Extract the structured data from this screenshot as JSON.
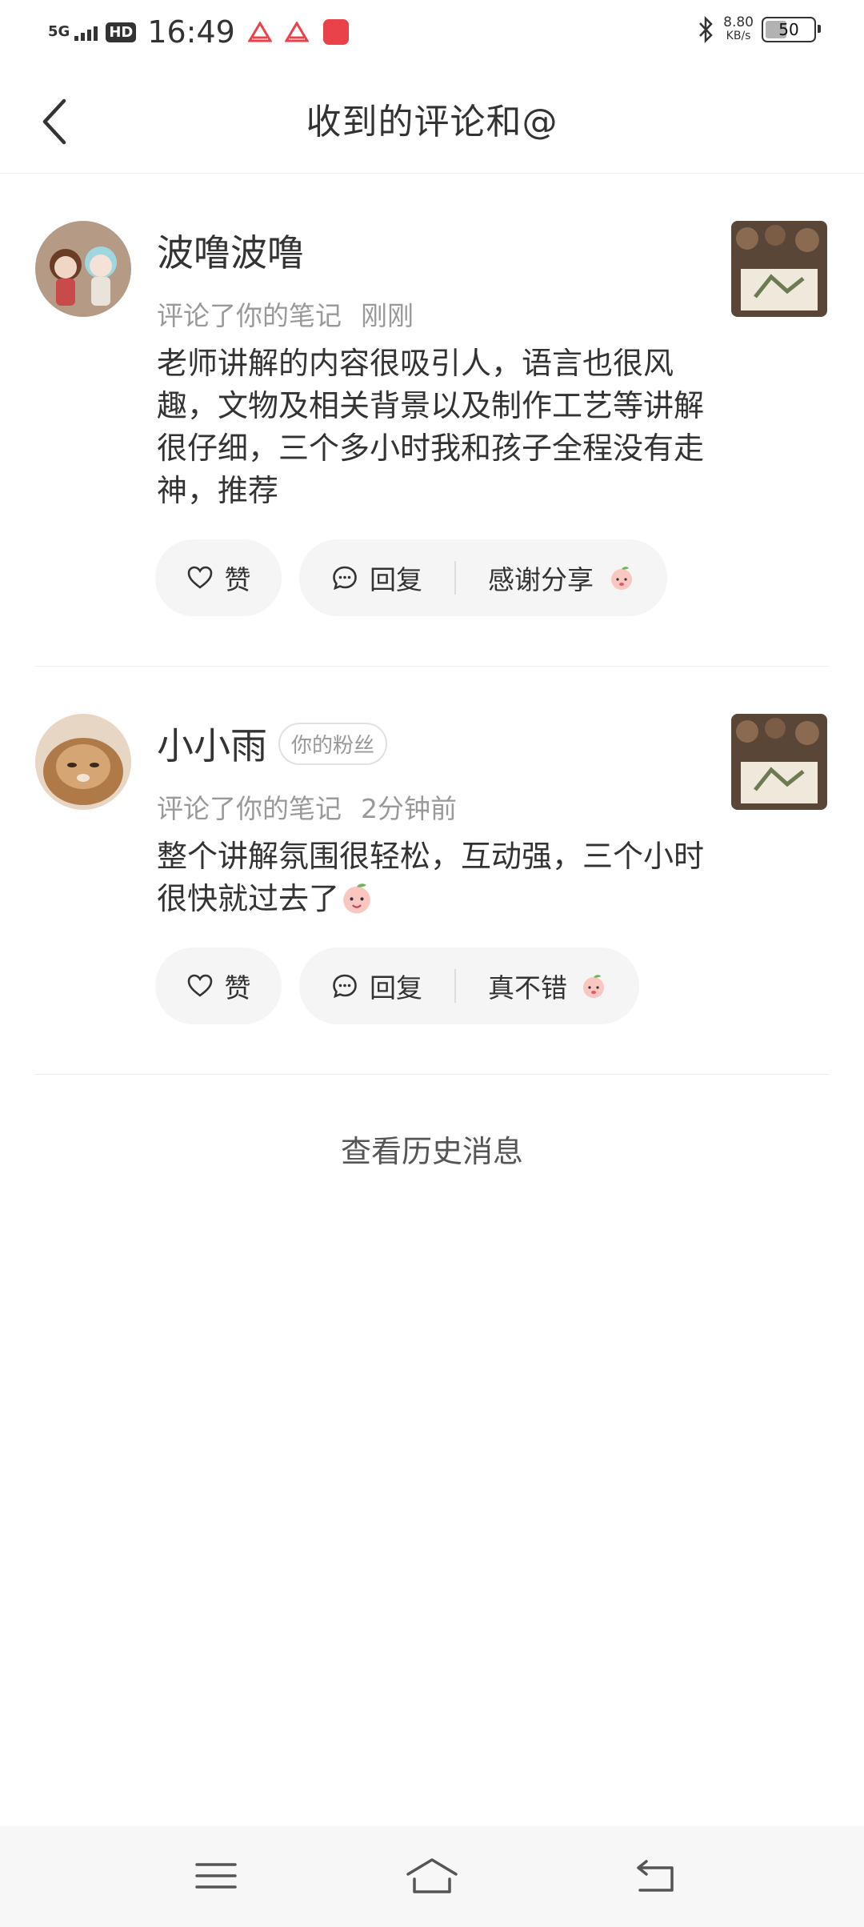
{
  "status_bar": {
    "network": "5G",
    "hd": "HD",
    "time": "16:49",
    "net_speed_value": "8.80",
    "net_speed_unit": "KB/s",
    "battery": "50",
    "battery_level_percent": 50
  },
  "header": {
    "title": "收到的评论和@"
  },
  "comments": [
    {
      "user": "波噜波噜",
      "tag": "",
      "action": "评论了你的笔记",
      "time": "刚刚",
      "text": "老师讲解的内容很吸引人，语言也很风趣，文物及相关背景以及制作工艺等讲解很仔细，三个多小时我和孩子全程没有走神，推荐",
      "like_label": "赞",
      "reply_label": "回复",
      "quick_reply": "感谢分享"
    },
    {
      "user": "小小雨",
      "tag": "你的粉丝",
      "action": "评论了你的笔记",
      "time": "2分钟前",
      "text": "整个讲解氛围很轻松，互动强，三个小时很快就过去了",
      "like_label": "赞",
      "reply_label": "回复",
      "quick_reply": "真不错"
    }
  ],
  "history_link": "查看历史消息",
  "navbar": {
    "icons": [
      "menu-icon",
      "home-icon",
      "back-icon"
    ]
  }
}
